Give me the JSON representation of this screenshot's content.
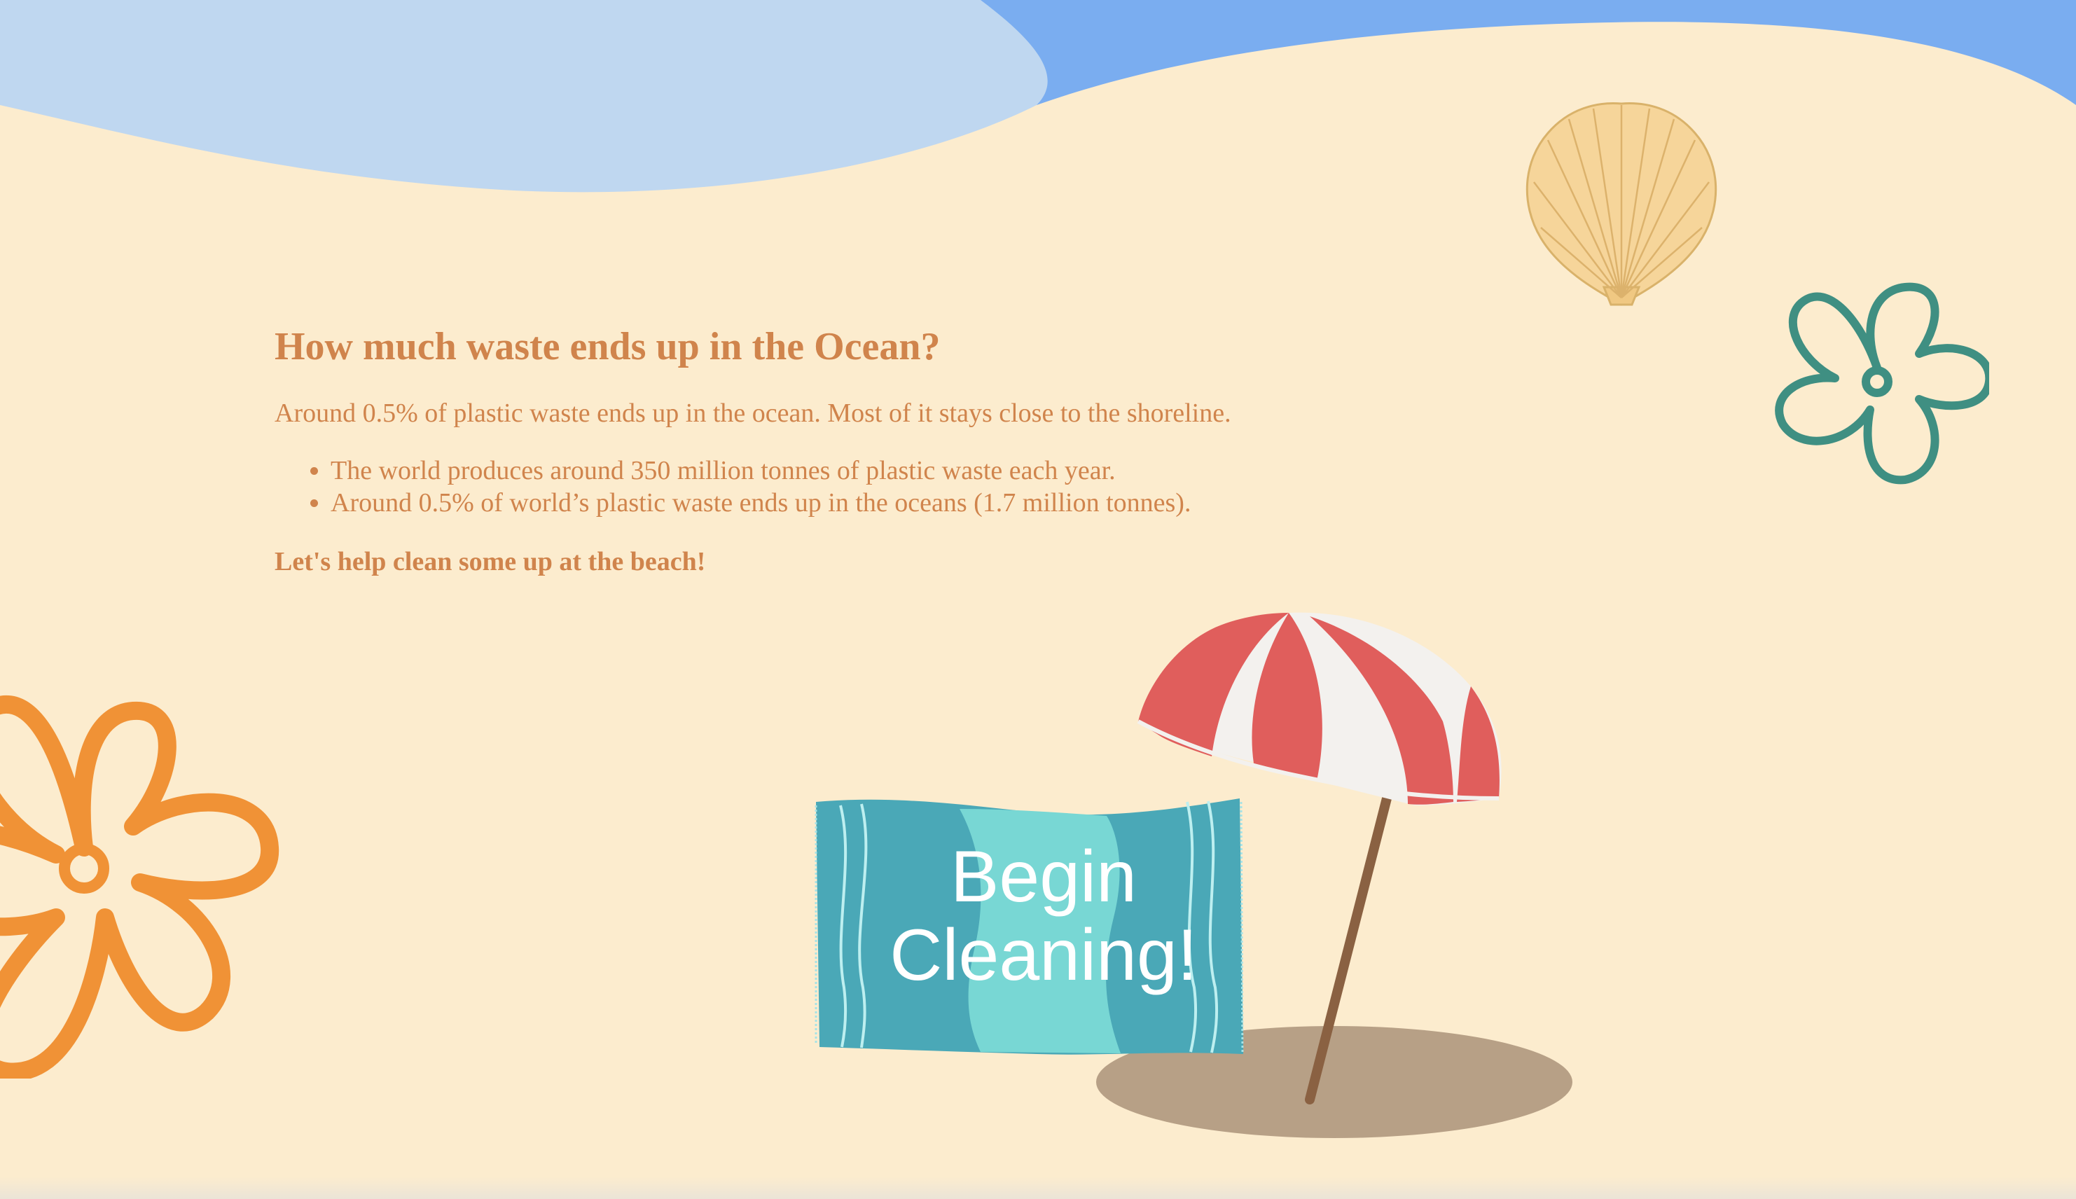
{
  "colors": {
    "sand": "#fcecce",
    "ocean_deep": "#7aadf0",
    "ocean_light": "#bfd7f0",
    "text": "#d0844c",
    "towel_dark": "#4aa8b7",
    "towel_light": "#78d7d4",
    "umbrella_red": "#e05e5c",
    "umbrella_white": "#f3f1ee",
    "flower_orange": "#f09236",
    "flower_green": "#3f8f82",
    "shell": "#f6d59a"
  },
  "article": {
    "heading": "How much waste ends up in the Ocean?",
    "intro": "Around 0.5% of plastic waste ends up in the ocean. Most of it stays close to the shoreline.",
    "facts": [
      "The world produces around 350 million tonnes of plastic waste each year.",
      "Around 0.5% of world’s plastic waste ends up in the oceans (1.7 million tonnes)."
    ],
    "cta": "Let's help clean some up at the beach!"
  },
  "button": {
    "line1": "Begin",
    "line2": "Cleaning!"
  },
  "icons": {
    "shell": "seashell-icon",
    "green_flower": "flower-icon",
    "orange_flower": "flower-icon",
    "umbrella": "beach-umbrella-icon",
    "towel": "beach-towel-icon"
  }
}
